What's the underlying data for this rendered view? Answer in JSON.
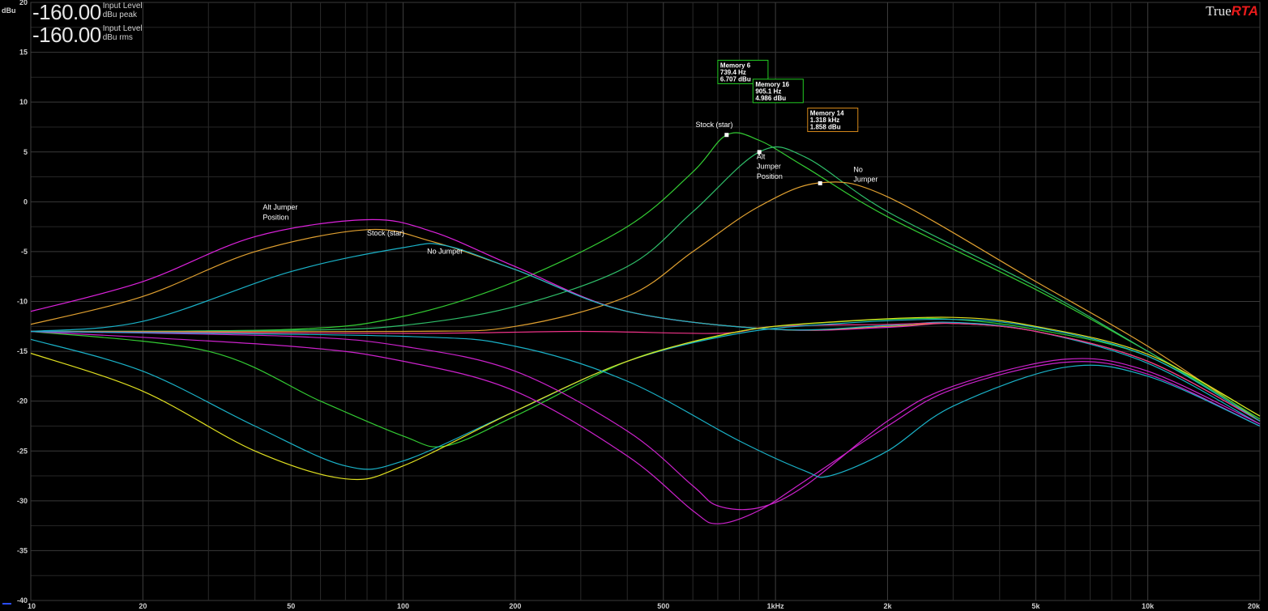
{
  "header": {
    "unit_label": "dBu",
    "meters": [
      {
        "value": "-160.00",
        "line1": "Input Level",
        "line2": "dBu peak"
      },
      {
        "value": "-160.00",
        "line1": "Input Level",
        "line2": "dBu rms"
      }
    ],
    "brand_plain": "True",
    "brand_accent": "RTA"
  },
  "chart_data": {
    "type": "line",
    "xscale": "log",
    "xlim": [
      10,
      20000
    ],
    "ylim": [
      -40,
      20
    ],
    "grid": true,
    "y_ticks": [
      20,
      15,
      10,
      5,
      0,
      -5,
      -10,
      -15,
      -20,
      -25,
      -30,
      -35,
      -40
    ],
    "x_ticks": [
      {
        "v": 10,
        "t": "10"
      },
      {
        "v": 20,
        "t": "20"
      },
      {
        "v": 50,
        "t": "50"
      },
      {
        "v": 100,
        "t": "100"
      },
      {
        "v": 200,
        "t": "200"
      },
      {
        "v": 500,
        "t": "500"
      },
      {
        "v": 1000,
        "t": "1kHz"
      },
      {
        "v": 2000,
        "t": "2k"
      },
      {
        "v": 5000,
        "t": "5k"
      },
      {
        "v": 10000,
        "t": "10k"
      },
      {
        "v": 20000,
        "t": "20k"
      }
    ],
    "series": [
      {
        "color": "#33cc33",
        "points": [
          [
            10,
            -13
          ],
          [
            50,
            -12.8
          ],
          [
            100,
            -11.5
          ],
          [
            200,
            -8
          ],
          [
            400,
            -2.5
          ],
          [
            600,
            3
          ],
          [
            739.4,
            6.7
          ],
          [
            900,
            6.2
          ],
          [
            1200,
            3.5
          ],
          [
            2000,
            -1.5
          ],
          [
            5000,
            -8.8
          ],
          [
            10000,
            -15
          ],
          [
            20000,
            -21.5
          ]
        ]
      },
      {
        "color": "#2fbf6a",
        "points": [
          [
            10,
            -13
          ],
          [
            50,
            -12.9
          ],
          [
            100,
            -12.4
          ],
          [
            200,
            -10.5
          ],
          [
            400,
            -6.5
          ],
          [
            600,
            -1
          ],
          [
            905.1,
            5
          ],
          [
            1200,
            4.5
          ],
          [
            2000,
            -1
          ],
          [
            5000,
            -8.5
          ],
          [
            10000,
            -15
          ],
          [
            20000,
            -21.8
          ]
        ]
      },
      {
        "color": "#e0a030",
        "points": [
          [
            10,
            -13
          ],
          [
            100,
            -13
          ],
          [
            200,
            -12.5
          ],
          [
            400,
            -9.5
          ],
          [
            600,
            -5
          ],
          [
            900,
            -0.5
          ],
          [
            1318,
            1.9
          ],
          [
            2000,
            0.5
          ],
          [
            5000,
            -8
          ],
          [
            10000,
            -14.5
          ],
          [
            20000,
            -22
          ]
        ]
      },
      {
        "color": "#dd22dd",
        "points": [
          [
            10,
            -11
          ],
          [
            20,
            -8
          ],
          [
            40,
            -3.5
          ],
          [
            80,
            -1.8
          ],
          [
            120,
            -3
          ],
          [
            200,
            -6.5
          ],
          [
            400,
            -11
          ],
          [
            1000,
            -12.8
          ],
          [
            2000,
            -12.6
          ],
          [
            3000,
            -12.2
          ],
          [
            5000,
            -13
          ],
          [
            10000,
            -16
          ],
          [
            20000,
            -22
          ]
        ]
      },
      {
        "color": "#e0a030",
        "points": [
          [
            10,
            -12.3
          ],
          [
            20,
            -9.5
          ],
          [
            40,
            -5
          ],
          [
            80,
            -2.8
          ],
          [
            120,
            -4
          ],
          [
            200,
            -6.8
          ],
          [
            400,
            -11
          ],
          [
            1000,
            -12.8
          ],
          [
            2000,
            -12.5
          ],
          [
            3000,
            -12.2
          ],
          [
            5000,
            -13
          ],
          [
            10000,
            -16
          ],
          [
            20000,
            -22
          ]
        ]
      },
      {
        "color": "#1ab2c8",
        "points": [
          [
            10,
            -13
          ],
          [
            20,
            -12
          ],
          [
            50,
            -7
          ],
          [
            100,
            -4.6
          ],
          [
            130,
            -4.4
          ],
          [
            200,
            -6.8
          ],
          [
            400,
            -11
          ],
          [
            1000,
            -12.8
          ],
          [
            2000,
            -12.4
          ],
          [
            3000,
            -12.1
          ],
          [
            5000,
            -13
          ],
          [
            10000,
            -16.2
          ],
          [
            20000,
            -22.3
          ]
        ]
      },
      {
        "color": "#ee3388",
        "points": [
          [
            10,
            -13
          ],
          [
            100,
            -13.2
          ],
          [
            300,
            -13
          ],
          [
            700,
            -13.2
          ],
          [
            1000,
            -12.5
          ],
          [
            2000,
            -12.3
          ],
          [
            3000,
            -12.2
          ],
          [
            5000,
            -13
          ],
          [
            10000,
            -16
          ],
          [
            20000,
            -22
          ]
        ]
      },
      {
        "color": "#33cc33",
        "points": [
          [
            10,
            -13
          ],
          [
            30,
            -15
          ],
          [
            60,
            -20
          ],
          [
            100,
            -23.5
          ],
          [
            130,
            -24.5
          ],
          [
            200,
            -21.5
          ],
          [
            400,
            -16
          ],
          [
            700,
            -13.5
          ],
          [
            1000,
            -12.5
          ],
          [
            2000,
            -11.8
          ],
          [
            3000,
            -11.8
          ],
          [
            5000,
            -12.8
          ],
          [
            10000,
            -15.5
          ],
          [
            20000,
            -21.8
          ]
        ]
      },
      {
        "color": "#1ab2c8",
        "points": [
          [
            10,
            -13.8
          ],
          [
            20,
            -17
          ],
          [
            40,
            -22.5
          ],
          [
            70,
            -26.5
          ],
          [
            100,
            -26
          ],
          [
            200,
            -21
          ],
          [
            400,
            -16
          ],
          [
            800,
            -13.2
          ],
          [
            1500,
            -12.2
          ],
          [
            3000,
            -11.8
          ],
          [
            5000,
            -12.6
          ],
          [
            10000,
            -15.5
          ],
          [
            20000,
            -22
          ]
        ]
      },
      {
        "color": "#e0e020",
        "points": [
          [
            10,
            -15.2
          ],
          [
            20,
            -19
          ],
          [
            40,
            -25
          ],
          [
            70,
            -27.8
          ],
          [
            100,
            -26.5
          ],
          [
            200,
            -21
          ],
          [
            400,
            -16
          ],
          [
            800,
            -13
          ],
          [
            1500,
            -12
          ],
          [
            3000,
            -11.6
          ],
          [
            5000,
            -12.5
          ],
          [
            10000,
            -15.3
          ],
          [
            20000,
            -21.5
          ]
        ]
      },
      {
        "color": "#cc22cc",
        "points": [
          [
            10,
            -13
          ],
          [
            50,
            -13.5
          ],
          [
            100,
            -14.5
          ],
          [
            200,
            -17
          ],
          [
            400,
            -23
          ],
          [
            600,
            -28.5
          ],
          [
            700,
            -30.5
          ],
          [
            900,
            -30.7
          ],
          [
            1200,
            -28.5
          ],
          [
            2000,
            -22
          ],
          [
            3000,
            -18.5
          ],
          [
            6000,
            -15.8
          ],
          [
            10000,
            -17
          ],
          [
            20000,
            -22.3
          ]
        ]
      },
      {
        "color": "#cc22cc",
        "points": [
          [
            10,
            -13
          ],
          [
            50,
            -14.5
          ],
          [
            100,
            -16
          ],
          [
            200,
            -19
          ],
          [
            400,
            -25.5
          ],
          [
            600,
            -31
          ],
          [
            700,
            -32.3
          ],
          [
            900,
            -31
          ],
          [
            1200,
            -28
          ],
          [
            2000,
            -22.5
          ],
          [
            3000,
            -18.8
          ],
          [
            6000,
            -16.1
          ],
          [
            10000,
            -17.3
          ],
          [
            20000,
            -22.5
          ]
        ]
      },
      {
        "color": "#1ab2c8",
        "points": [
          [
            10,
            -13
          ],
          [
            100,
            -13.5
          ],
          [
            200,
            -14.5
          ],
          [
            400,
            -18
          ],
          [
            800,
            -24
          ],
          [
            1200,
            -27
          ],
          [
            1400,
            -27.5
          ],
          [
            2000,
            -25
          ],
          [
            3000,
            -20.5
          ],
          [
            6000,
            -16.6
          ],
          [
            10000,
            -17.5
          ],
          [
            20000,
            -22.5
          ]
        ]
      }
    ],
    "annotations": [
      {
        "text": "Stock (star)",
        "x": 610,
        "y": 7.5
      },
      {
        "text": "Alt",
        "x": 890,
        "y": 4.3
      },
      {
        "text": "Jumper",
        "x": 890,
        "y": 3.3
      },
      {
        "text": "Position",
        "x": 890,
        "y": 2.3
      },
      {
        "text": "No",
        "x": 1620,
        "y": 3.0
      },
      {
        "text": "Jumper",
        "x": 1620,
        "y": 2.0
      },
      {
        "text": "Alt Jumper",
        "x": 42,
        "y": -0.8
      },
      {
        "text": "Position",
        "x": 42,
        "y": -1.8
      },
      {
        "text": "Stock (star)",
        "x": 80,
        "y": -3.4
      },
      {
        "text": "No Jumper",
        "x": 116,
        "y": -5.2
      }
    ],
    "markers": [
      {
        "x": 739.4,
        "y": 6.707
      },
      {
        "x": 905.1,
        "y": 4.986
      },
      {
        "x": 1318,
        "y": 1.858
      }
    ],
    "memory_boxes": [
      {
        "title": "Memory 6",
        "freq": "739.4 Hz",
        "level": "6.707 dBu",
        "color": "#22cc22",
        "x": 700,
        "y": 14.2
      },
      {
        "title": "Memory 16",
        "freq": "905.1 Hz",
        "level": "4.986 dBu",
        "color": "#22cc22",
        "x": 870,
        "y": 12.3
      },
      {
        "title": "Memory 14",
        "freq": "1.318 kHz",
        "level": "1.858 dBu",
        "color": "#d88a1a",
        "x": 1220,
        "y": 9.4
      }
    ]
  }
}
